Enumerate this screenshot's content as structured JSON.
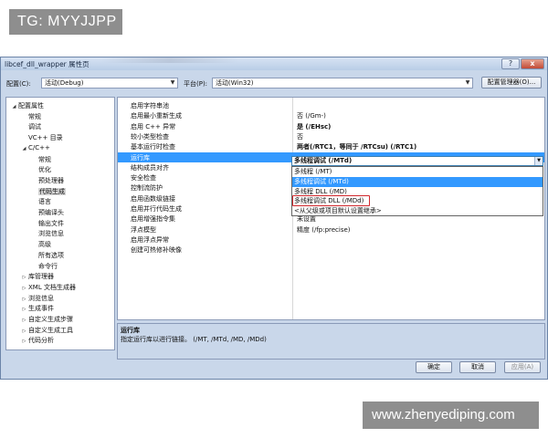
{
  "watermarks": {
    "top": "TG: MYYJJPP",
    "bottom": "www.zhenyediping.com"
  },
  "window": {
    "title": "libcef_dll_wrapper 属性页",
    "help_button": "?",
    "close_button": "x"
  },
  "config_bar": {
    "config_label": "配置(C):",
    "config_value": "活动(Debug)",
    "platform_label": "平台(P):",
    "platform_value": "活动(Win32)",
    "manager_button": "配置管理器(O)..."
  },
  "tree": [
    {
      "label": "配置属性",
      "level": 0,
      "toggle": "◢"
    },
    {
      "label": "常规",
      "level": 1
    },
    {
      "label": "调试",
      "level": 1
    },
    {
      "label": "VC++ 目录",
      "level": 1
    },
    {
      "label": "C/C++",
      "level": 1,
      "toggle": "◢"
    },
    {
      "label": "常规",
      "level": 2
    },
    {
      "label": "优化",
      "level": 2
    },
    {
      "label": "预处理器",
      "level": 2
    },
    {
      "label": "代码生成",
      "level": 2,
      "selected": true
    },
    {
      "label": "语言",
      "level": 2
    },
    {
      "label": "预编译头",
      "level": 2
    },
    {
      "label": "输出文件",
      "level": 2
    },
    {
      "label": "浏览信息",
      "level": 2
    },
    {
      "label": "高级",
      "level": 2
    },
    {
      "label": "所有选项",
      "level": 2
    },
    {
      "label": "命令行",
      "level": 2
    },
    {
      "label": "库管理器",
      "level": 1,
      "toggle": "▷"
    },
    {
      "label": "XML 文档生成器",
      "level": 1,
      "toggle": "▷"
    },
    {
      "label": "浏览信息",
      "level": 1,
      "toggle": "▷"
    },
    {
      "label": "生成事件",
      "level": 1,
      "toggle": "▷"
    },
    {
      "label": "自定义生成步骤",
      "level": 1,
      "toggle": "▷"
    },
    {
      "label": "自定义生成工具",
      "level": 1,
      "toggle": "▷"
    },
    {
      "label": "代码分析",
      "level": 1,
      "toggle": "▷"
    }
  ],
  "properties": [
    {
      "name": "启用字符串池",
      "value": ""
    },
    {
      "name": "启用最小重新生成",
      "value": "否 (/Gm-)"
    },
    {
      "name": "启用 C++ 异常",
      "value": "是 (/EHsc)",
      "bold": true
    },
    {
      "name": "较小类型检查",
      "value": "否"
    },
    {
      "name": "基本运行时检查",
      "value": "两者(/RTC1，等同于 /RTCsu) (/RTC1)",
      "bold": true
    },
    {
      "name": "运行库",
      "value": "",
      "selected": true
    },
    {
      "name": "结构成员对齐",
      "value": ""
    },
    {
      "name": "安全检查",
      "value": ""
    },
    {
      "name": "控制流防护",
      "value": ""
    },
    {
      "name": "启用函数级链接",
      "value": ""
    },
    {
      "name": "启用并行代码生成",
      "value": ""
    },
    {
      "name": "启用增强指令集",
      "value": "未设置"
    },
    {
      "name": "浮点模型",
      "value": "精度 (/fp:precise)"
    },
    {
      "name": "启用浮点异常",
      "value": ""
    },
    {
      "name": "创建可热修补映像",
      "value": ""
    }
  ],
  "runtime_combo": {
    "value": "多线程调试 (/MTd)",
    "arrow": "▼",
    "options": [
      {
        "label": "多线程 (/MT)"
      },
      {
        "label": "多线程调试 (/MTd)",
        "highlighted": true
      },
      {
        "label": "多线程 DLL (/MD)"
      },
      {
        "label": "多线程调试 DLL (/MDd)",
        "boxed": true
      },
      {
        "label": "<从父级或项目默认设置继承>"
      }
    ]
  },
  "description": {
    "heading": "运行库",
    "text": "指定运行库以进行链接。      (/MT, /MTd, /MD, /MDd)"
  },
  "buttons": {
    "ok": "确定",
    "cancel": "取消",
    "apply": "应用(A)"
  },
  "colors": {
    "selection": "#3399ff",
    "highlight_box": "#d0282d",
    "dialog_bg": "#c9d7ea"
  }
}
